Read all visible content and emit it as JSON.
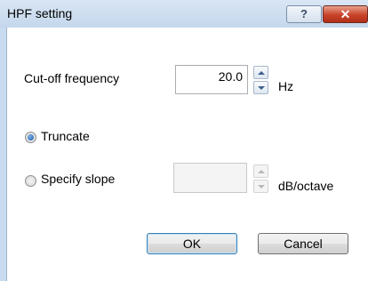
{
  "window": {
    "title": "HPF setting",
    "help_label": "?",
    "close_label": "✕"
  },
  "cutoff": {
    "label": "Cut-off frequency",
    "value": "20.0",
    "unit": "Hz"
  },
  "options": {
    "truncate_label": "Truncate",
    "truncate_selected": true,
    "specify_slope_label": "Specify slope",
    "specify_slope_selected": false,
    "slope_value": "",
    "slope_unit": "dB/octave"
  },
  "buttons": {
    "ok": "OK",
    "cancel": "Cancel"
  }
}
